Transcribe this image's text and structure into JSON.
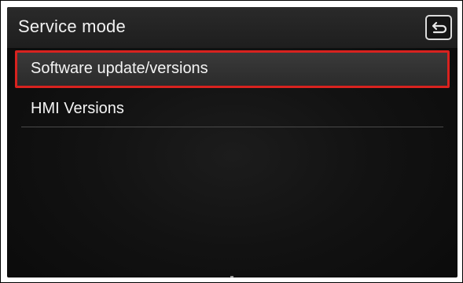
{
  "header": {
    "title": "Service mode",
    "back_icon": "back-arrow-icon"
  },
  "menu": {
    "items": [
      {
        "label": "Software update/versions",
        "selected": true
      },
      {
        "label": "HMI Versions",
        "selected": false
      }
    ]
  },
  "colors": {
    "selection_border": "#d8221f",
    "background": "#121212",
    "text": "#f4f4f4"
  }
}
